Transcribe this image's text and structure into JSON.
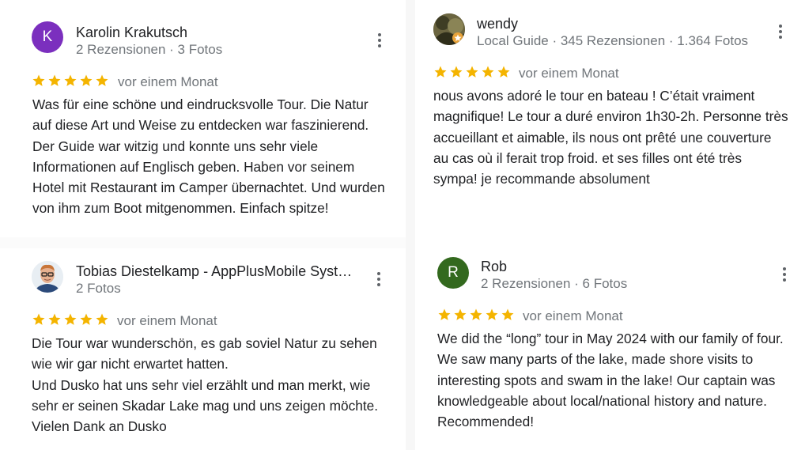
{
  "colors": {
    "star": "#f4b400",
    "avatar_purple": "#7b2fbe",
    "avatar_green": "#33691e",
    "meta": "#70757a"
  },
  "reviews": [
    {
      "author": "Karolin Krakutsch",
      "avatar_letter": "K",
      "meta": "2 Rezensionen · 3 Fotos",
      "rating": 5,
      "date": "vor einem Monat",
      "text_lines": [
        "Was für eine schöne und eindrucksvolle Tour. Die Natur",
        "auf diese Art und Weise zu entdecken war faszinierend.",
        "Der Guide war witzig und konnte uns sehr viele",
        "Informationen auf Englisch geben. Haben vor seinem",
        "Hotel mit Restaurant im Camper übernachtet. Und wurden",
        "von ihm zum Boot mitgenommen. Einfach spitze!"
      ]
    },
    {
      "author": "wendy",
      "avatar_icon": "photo-avatar",
      "meta": "Local Guide · 345 Rezensionen · 1.364 Fotos",
      "rating": 5,
      "date": "vor einem Monat",
      "text_lines": [
        "nous avons adoré le tour en bateau ! C’était vraiment",
        "magnifique! Le tour a duré environ 1h30-2h. Personne très",
        "accueillant et aimable, ils nous ont prêté une couverture",
        "au cas où il ferait trop froid. et ses filles ont été très",
        "sympa! je recommande absolument"
      ]
    },
    {
      "author": "Tobias Diestelkamp - AppPlusMobile Syst…",
      "avatar_icon": "photo-avatar",
      "meta": "2 Fotos",
      "rating": 5,
      "date": "vor einem Monat",
      "text_lines": [
        "Die Tour war wunderschön, es gab soviel Natur zu sehen",
        "wie wir gar nicht erwartet hatten.",
        "Und Dusko hat uns sehr viel erzählt und man merkt, wie",
        "sehr er seinen Skadar Lake mag und uns zeigen möchte.",
        "Vielen Dank an Dusko"
      ]
    },
    {
      "author": "Rob",
      "avatar_letter": "R",
      "meta": "2 Rezensionen · 6 Fotos",
      "rating": 5,
      "date": "vor einem Monat",
      "text_lines": [
        "We did the “long” tour in May 2024 with our family of four.",
        "We saw many parts of the lake, made shore visits to",
        "interesting spots and swam in the lake! Our captain was",
        "knowledgeable about local/national history and nature.",
        "Recommended!"
      ]
    }
  ]
}
